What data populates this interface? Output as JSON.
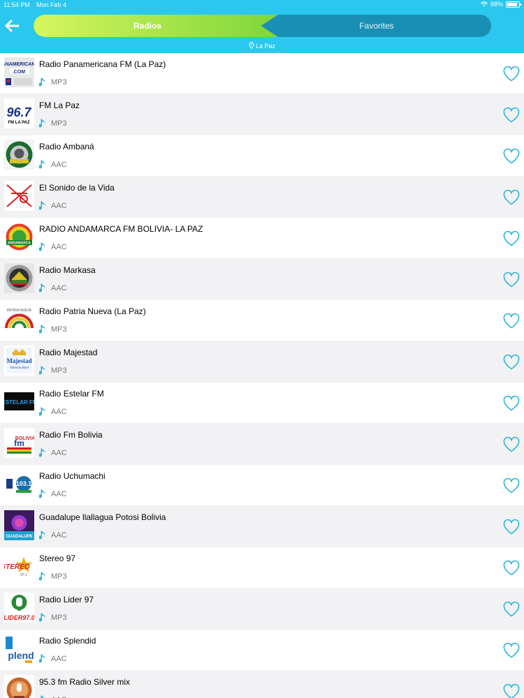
{
  "status": {
    "time": "11:54 PM",
    "date": "Mon Feb 4",
    "battery": "88%",
    "battery_level": 0.88
  },
  "header": {
    "tabs": [
      {
        "label": "Radios"
      },
      {
        "label": "Favorites"
      }
    ],
    "location": "La Paz"
  },
  "colors": {
    "header_bg": "#2bc7ef",
    "accent": "#2bb5d8",
    "active_tab": "#9ee24a"
  },
  "stations": [
    {
      "name": "Radio Panamericana FM (La Paz)",
      "format": "MP3",
      "logo": "panamericana-logo"
    },
    {
      "name": "FM La Paz",
      "format": "MP3",
      "logo": "fm-la-paz-logo"
    },
    {
      "name": "Radio Ambaná",
      "format": "AAC",
      "logo": "ambana-logo"
    },
    {
      "name": "El Sonido de la Vida",
      "format": "AAC",
      "logo": "sonido-vida-logo"
    },
    {
      "name": "RADIO ANDAMARCA FM BOLIVIA- LA PAZ",
      "format": "AAC",
      "logo": "andamarca-logo"
    },
    {
      "name": "Radio Markasa",
      "format": "AAC",
      "logo": "markasa-logo"
    },
    {
      "name": "Radio Patria Nueva (La Paz)",
      "format": "MP3",
      "logo": "patria-nueva-logo"
    },
    {
      "name": "Radio Majestad",
      "format": "MP3",
      "logo": "majestad-logo"
    },
    {
      "name": "Radio Estelar FM",
      "format": "AAC",
      "logo": "estelar-logo"
    },
    {
      "name": "Radio Fm Bolivia",
      "format": "AAC",
      "logo": "fm-bolivia-logo"
    },
    {
      "name": "Radio Uchumachi",
      "format": "AAC",
      "logo": "uchumachi-logo"
    },
    {
      "name": "Guadalupe llallagua Potosi Bolivia",
      "format": "AAC",
      "logo": "guadalupe-logo"
    },
    {
      "name": "Stereo 97",
      "format": "MP3",
      "logo": "stereo-97-logo"
    },
    {
      "name": "Radio Lider 97",
      "format": "MP3",
      "logo": "lider-97-logo"
    },
    {
      "name": "Radio Splendid",
      "format": "AAC",
      "logo": "splendid-logo"
    },
    {
      "name": "95.3 fm Radio Silver mix",
      "format": "AAC",
      "logo": "silver-mix-logo"
    }
  ]
}
